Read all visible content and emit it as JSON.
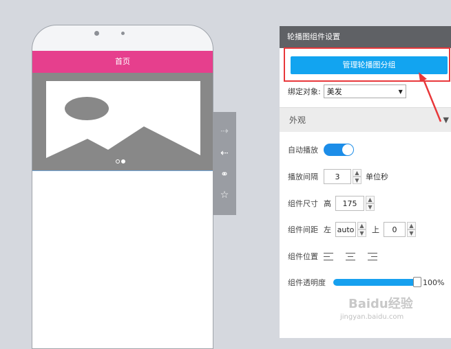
{
  "phone": {
    "header_title": "首页"
  },
  "carousel": {
    "dots": 2,
    "active_dot": 2
  },
  "toolbar": {
    "icons": [
      "arrow-right-icon",
      "arrow-left-icon",
      "component-group-icon",
      "star-icon"
    ]
  },
  "panel": {
    "title": "轮播图组件设置",
    "manage_button": "管理轮播图分组",
    "bind_label": "绑定对象:",
    "bind_value": "美发",
    "section_title": "外观",
    "autoplay_label": "自动播放",
    "autoplay_on": true,
    "interval_label": "播放间隔",
    "interval_value": "3",
    "interval_unit": "单位秒",
    "size_label": "组件尺寸",
    "height_label": "高",
    "height_value": "175",
    "spacing_label": "组件间距",
    "left_label": "左",
    "left_value": "auto",
    "top_label": "上",
    "top_value": "0",
    "position_label": "组件位置",
    "opacity_label": "组件透明度",
    "opacity_value": "100%",
    "opacity_fraction": 1.0
  },
  "watermark": {
    "text": "Baidu经验",
    "sub": "jingyan.baidu.com"
  },
  "colors": {
    "header_pink": "#e63f8d",
    "accent_blue": "#12a4f0",
    "highlight_red": "#e8373a",
    "panel_title_bg": "#5f6165"
  }
}
